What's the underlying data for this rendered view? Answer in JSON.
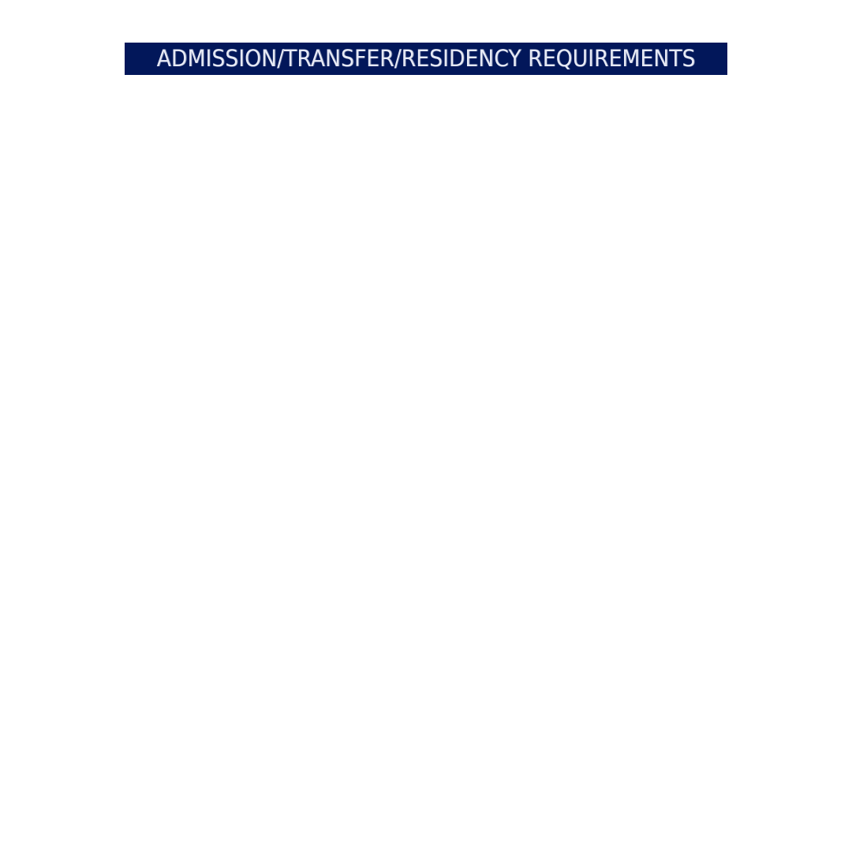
{
  "banner": {
    "title": "ADMISSION/TRANSFER/RESIDENCY REQUIREMENTS",
    "background_color": "#02175a",
    "text_color": "#e6e9f5"
  },
  "page": {
    "background_color": "#ffffff"
  }
}
